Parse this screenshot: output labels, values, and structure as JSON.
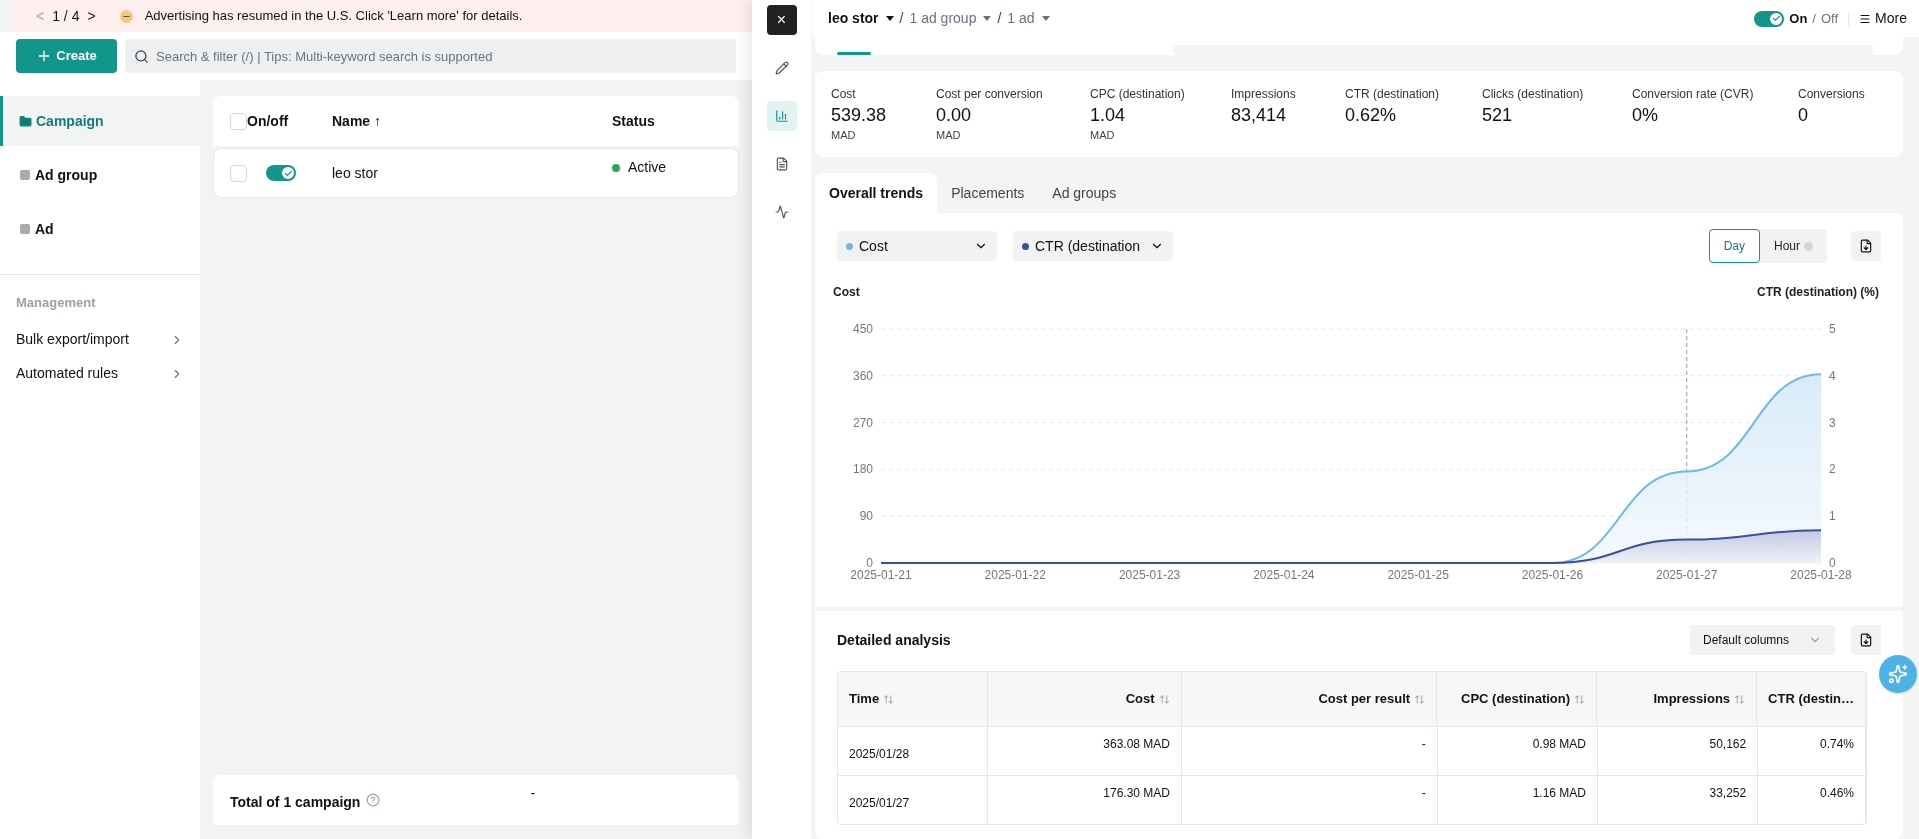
{
  "banner": {
    "prev": "<",
    "page": "1 / 4",
    "next": ">",
    "message": "Advertising has resumed in the U.S. Click 'Learn more' for details."
  },
  "toolbar": {
    "create_button": "Create",
    "search": {
      "placeholder": "Search & filter (/) | Tips: Multi-keyword search is supported"
    }
  },
  "sidebar": {
    "items": [
      {
        "label": "Campaign",
        "selected": true
      },
      {
        "label": "Ad group",
        "selected": false
      },
      {
        "label": "Ad",
        "selected": false
      }
    ],
    "management": {
      "heading": "Management",
      "items": [
        "Bulk export/import",
        "Automated rules"
      ]
    }
  },
  "campaign_table": {
    "select_all_checked": false,
    "columns": [
      "On/off",
      "Name ↑",
      "Status"
    ],
    "rows": [
      {
        "checked": false,
        "on": true,
        "name": "leo stor",
        "status": "Active",
        "color": "#2ea44f"
      }
    ],
    "total": {
      "label": "Total of 1 campaign",
      "status": "-"
    }
  },
  "drawer": {
    "close": "×",
    "rail": [
      {
        "selected": false
      },
      {
        "selected": true
      },
      {
        "selected": false
      },
      {
        "selected": false
      }
    ],
    "breadcrumb": [
      {
        "label": "leo stor",
        "current": true
      },
      {
        "label": "1 ad group",
        "current": false
      },
      {
        "label": "1 ad",
        "current": false
      }
    ],
    "separator": "/",
    "status_toggle": {
      "on": true,
      "on_label": "On",
      "slash": "/",
      "off_label": "Off"
    },
    "more": "More",
    "stats": [
      {
        "label": "Cost",
        "value": "539.38",
        "unit": "MAD"
      },
      {
        "label": "Cost per conversion",
        "value": "0.00",
        "unit": "MAD"
      },
      {
        "label": "CPC (destination)",
        "value": "1.04",
        "unit": "MAD"
      },
      {
        "label": "Impressions",
        "value": "83,414"
      },
      {
        "label": "CTR (destination)",
        "value": "0.62%"
      },
      {
        "label": "Clicks (destination)",
        "value": "521"
      },
      {
        "label": "Conversion rate (CVR)",
        "value": "0%"
      },
      {
        "label": "Conversions",
        "value": "0"
      }
    ],
    "tabs": [
      {
        "label": "Overall trends",
        "selected": true
      },
      {
        "label": "Placements",
        "selected": false
      },
      {
        "label": "Ad groups",
        "selected": false
      }
    ],
    "granularity": [
      {
        "label": "Day",
        "selected": true
      },
      {
        "label": "Hour",
        "selected": false
      }
    ],
    "chart_data": {
      "type": "area",
      "legend": "top-left",
      "ylabel": "Cost",
      "y2label": "CTR (destination) (%)",
      "grid": true,
      "categories": [
        "2025-01-21",
        "2025-01-22",
        "2025-01-23",
        "2025-01-24",
        "2025-01-25",
        "2025-01-26",
        "2025-01-27",
        "2025-01-28"
      ],
      "series": [
        {
          "name": "Cost",
          "color": "#6cb8ec",
          "values": [
            null,
            null,
            null,
            null,
            null,
            0,
            176,
            363
          ]
        },
        {
          "name": "CTR (destination",
          "color": "#3a4fa0",
          "axis": "y2",
          "values": [
            0,
            0,
            0,
            0,
            0,
            0,
            0.5,
            0.7
          ]
        }
      ],
      "ylim": [
        0,
        450
      ],
      "yticks": [
        0,
        90,
        180,
        270,
        360,
        450
      ],
      "y2lim": [
        0,
        5
      ],
      "y2ticks": [
        0,
        1,
        2,
        3,
        4,
        5
      ],
      "ref_lines": [
        {
          "axis": "x",
          "value": "2025-01-27"
        }
      ]
    },
    "detail": {
      "title": "Detailed analysis",
      "columns_select": "Default columns",
      "columns": [
        "Time",
        "Cost",
        "Cost per result",
        "CPC (destination)",
        "Impressions",
        "CTR (destin…"
      ],
      "rows": [
        [
          "2025/01/28",
          "363.08 MAD",
          "-",
          "0.98 MAD",
          "50,162",
          "0.74%"
        ],
        [
          "2025/01/27",
          "176.30 MAD",
          "-",
          "1.16 MAD",
          "33,252",
          "0.46%"
        ]
      ]
    }
  }
}
